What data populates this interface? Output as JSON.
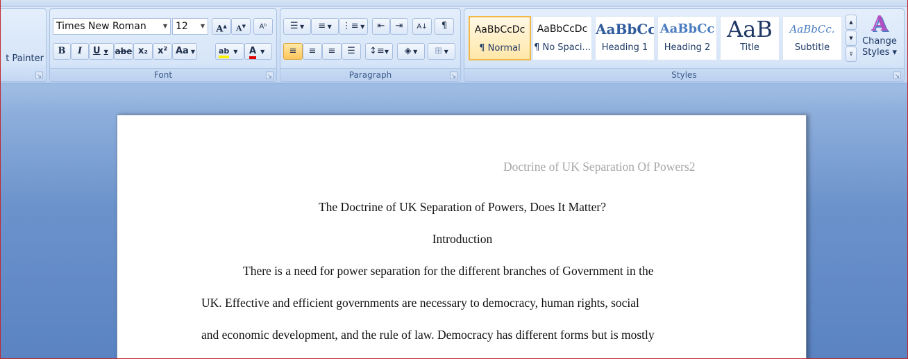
{
  "clipboard": {
    "format_painter_label": "t Painter"
  },
  "font": {
    "group_label": "Font",
    "font_name": "Times New Roman",
    "font_size": "12",
    "bold": "B",
    "italic": "I",
    "underline": "U",
    "strikethrough": "abe",
    "subscript": "x₂",
    "superscript": "x²",
    "change_case": "Aa",
    "grow": "A",
    "shrink": "A",
    "highlight": "ab",
    "font_color": "A"
  },
  "paragraph": {
    "group_label": "Paragraph",
    "pilcrow": "¶"
  },
  "styles": {
    "group_label": "Styles",
    "tiles": [
      {
        "preview": "AaBbCcDc",
        "name": "¶ Normal"
      },
      {
        "preview": "AaBbCcDc",
        "name": "¶ No Spaci..."
      },
      {
        "preview": "AaBbCc",
        "name": "Heading 1"
      },
      {
        "preview": "AaBbCc",
        "name": "Heading 2"
      },
      {
        "preview": "AaB",
        "name": "Title"
      },
      {
        "preview": "AaBbCc.",
        "name": "Subtitle"
      }
    ],
    "change_styles_line1": "Change",
    "change_styles_line2": "Styles ▾"
  },
  "document": {
    "header": "Doctrine of UK Separation Of Powers",
    "page_number": "2",
    "title": "The Doctrine of UK Separation of Powers, Does It Matter?",
    "heading": "Introduction",
    "lines": [
      "There is a need for power separation for the different branches of Government in the",
      "UK. Effective and efficient governments are necessary to democracy, human rights, social",
      "and economic development, and the rule of law. Democracy has different forms but is mostly"
    ]
  },
  "colors": {
    "accent": "#f2b847",
    "ribbon_text": "#1e3a66",
    "font_color_bar": "#e00000",
    "highlight_bar": "#ffef00"
  }
}
